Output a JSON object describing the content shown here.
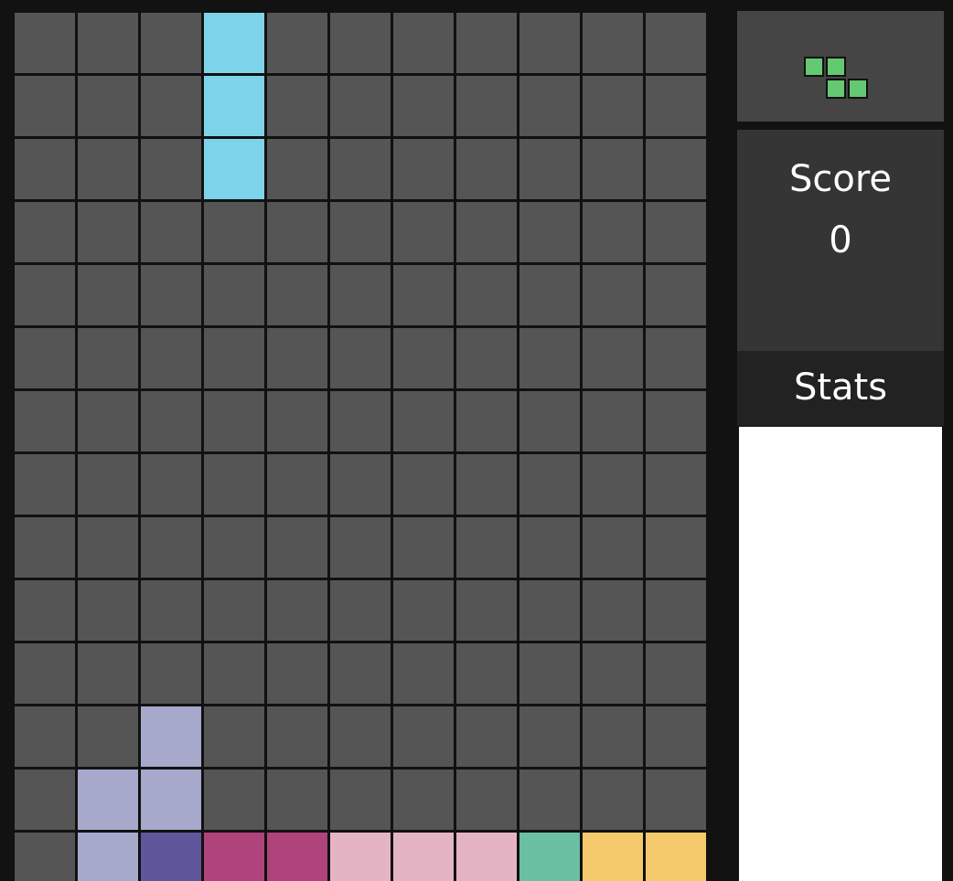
{
  "board": {
    "rows": 14,
    "cols": 11,
    "empty_color": "#555555",
    "grid_color": "#111111",
    "filled_cells": [
      {
        "row": 0,
        "col": 3,
        "color": "#7dd3e8",
        "piece": "I"
      },
      {
        "row": 1,
        "col": 3,
        "color": "#7dd3e8",
        "piece": "I"
      },
      {
        "row": 2,
        "col": 3,
        "color": "#7dd3e8",
        "piece": "I"
      },
      {
        "row": 11,
        "col": 2,
        "color": "#a6a8cc",
        "piece": "T"
      },
      {
        "row": 12,
        "col": 1,
        "color": "#a6a8cc",
        "piece": "T"
      },
      {
        "row": 12,
        "col": 2,
        "color": "#a6a8cc",
        "piece": "T"
      },
      {
        "row": 13,
        "col": 1,
        "color": "#a6a8cc",
        "piece": "T"
      },
      {
        "row": 13,
        "col": 2,
        "color": "#5f569c",
        "piece": "J"
      },
      {
        "row": 13,
        "col": 3,
        "color": "#ae447b",
        "piece": "Z"
      },
      {
        "row": 13,
        "col": 4,
        "color": "#ae447b",
        "piece": "Z"
      },
      {
        "row": 13,
        "col": 5,
        "color": "#e4b3c4",
        "piece": "L"
      },
      {
        "row": 13,
        "col": 6,
        "color": "#e4b3c4",
        "piece": "L"
      },
      {
        "row": 13,
        "col": 7,
        "color": "#e4b3c4",
        "piece": "L"
      },
      {
        "row": 13,
        "col": 8,
        "color": "#6bbfa3",
        "piece": "S"
      },
      {
        "row": 13,
        "col": 9,
        "color": "#f5ca6c",
        "piece": "O"
      },
      {
        "row": 13,
        "col": 10,
        "color": "#f5ca6c",
        "piece": "O"
      }
    ]
  },
  "next_piece": {
    "shape": "Z",
    "color": "#65c873",
    "icon": "z-tetromino-icon",
    "cells": [
      {
        "row": 0,
        "col": 0
      },
      {
        "row": 0,
        "col": 1
      },
      {
        "row": 1,
        "col": 1
      },
      {
        "row": 1,
        "col": 2
      }
    ]
  },
  "score": {
    "label": "Score",
    "value": "0"
  },
  "stats": {
    "label": "Stats"
  }
}
